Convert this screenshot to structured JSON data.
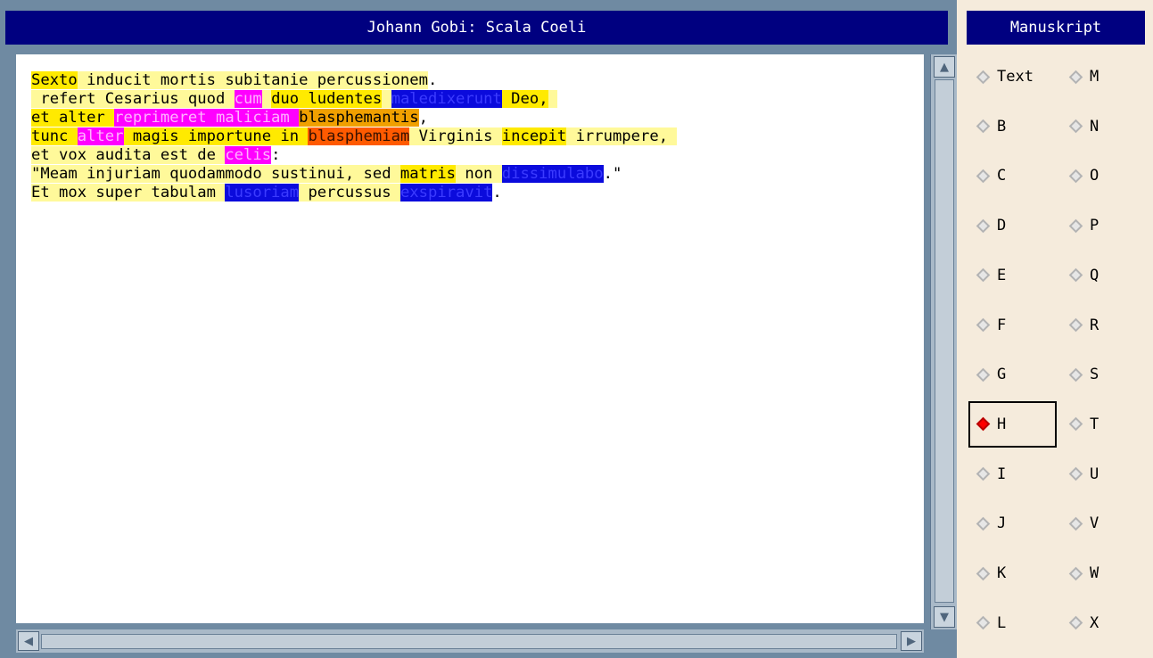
{
  "window": {
    "title": "Johann Gobi: Scala Coeli"
  },
  "text_lines": [
    [
      {
        "t": "Sexto",
        "c": "hl-bright"
      },
      {
        "t": " inducit mortis ",
        "c": "hl-yellow"
      },
      {
        "t": "subitanie percussionem",
        "c": "hl-yellow"
      },
      {
        "t": ".",
        "c": ""
      }
    ],
    [
      {
        "t": " refert Cesarius quod ",
        "c": "hl-yellow"
      },
      {
        "t": "cum",
        "c": "hl-magenta"
      },
      {
        "t": " ",
        "c": "hl-yellow"
      },
      {
        "t": "duo ludentes",
        "c": "hl-bright"
      },
      {
        "t": " ",
        "c": "hl-yellow"
      },
      {
        "t": "maledixerunt",
        "c": "hl-blue"
      },
      {
        "t": " Deo,",
        "c": "hl-bright"
      },
      {
        "t": " ",
        "c": "hl-yellow"
      }
    ],
    [
      {
        "t": "et alter ",
        "c": "hl-bright"
      },
      {
        "t": "reprimeret maliciam ",
        "c": "hl-magenta"
      },
      {
        "t": "blasphemantis",
        "c": "hl-amber"
      },
      {
        "t": ",",
        "c": ""
      }
    ],
    [
      {
        "t": "tunc ",
        "c": "hl-bright"
      },
      {
        "t": "alter",
        "c": "hl-magenta"
      },
      {
        "t": " magis importune in ",
        "c": "hl-bright"
      },
      {
        "t": "blasphemiam",
        "c": "hl-orange"
      },
      {
        "t": " Virginis ",
        "c": "hl-yellow"
      },
      {
        "t": "incepit",
        "c": "hl-bright"
      },
      {
        "t": " irrumpere, ",
        "c": "hl-yellow"
      }
    ],
    [
      {
        "t": "et vox audita est de ",
        "c": "hl-yellow"
      },
      {
        "t": "celis",
        "c": "hl-magenta"
      },
      {
        "t": ":",
        "c": ""
      }
    ],
    [
      {
        "t": "\"Meam injuriam quodammodo sustinui, sed ",
        "c": "hl-yellow"
      },
      {
        "t": "matris",
        "c": "hl-bright"
      },
      {
        "t": " non ",
        "c": "hl-yellow"
      },
      {
        "t": "dissimulabo",
        "c": "hl-blue"
      },
      {
        "t": ".\"",
        "c": ""
      }
    ],
    [
      {
        "t": "Et mox super tabulam ",
        "c": "hl-yellow"
      },
      {
        "t": "lusoriam",
        "c": "hl-blue"
      },
      {
        "t": " percussus ",
        "c": "hl-yellow"
      },
      {
        "t": "exspiravit",
        "c": "hl-blue"
      },
      {
        "t": ".",
        "c": ""
      }
    ]
  ],
  "manuscript_panel": {
    "title": "Manuskript",
    "selected": "H",
    "options_left": [
      "Text",
      "B",
      "C",
      "D",
      "E",
      "F",
      "G",
      "H",
      "I",
      "J",
      "K",
      "L"
    ],
    "options_right": [
      "M",
      "N",
      "O",
      "P",
      "Q",
      "R",
      "S",
      "T",
      "U",
      "V",
      "W",
      "X"
    ]
  },
  "icons": {
    "scroll_up": "triangle-up",
    "scroll_down": "triangle-down",
    "scroll_left": "triangle-left",
    "scroll_right": "triangle-right",
    "radio": "diamond"
  }
}
